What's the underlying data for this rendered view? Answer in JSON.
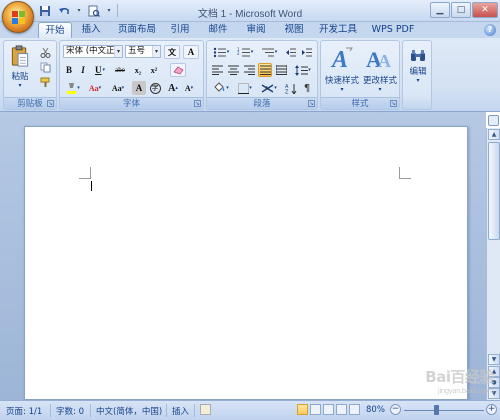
{
  "window": {
    "title": "文档 1 - Microsoft Word",
    "controls": [
      "minimize",
      "maximize",
      "close"
    ]
  },
  "quick_access": [
    "save-icon",
    "undo-icon",
    "redo-icon",
    "print-preview-icon",
    "customize-dropdown-icon"
  ],
  "tabs": [
    {
      "label": "开始",
      "active": true
    },
    {
      "label": "插入"
    },
    {
      "label": "页面布局"
    },
    {
      "label": "引用"
    },
    {
      "label": "邮件"
    },
    {
      "label": "审阅"
    },
    {
      "label": "视图"
    },
    {
      "label": "开发工具"
    },
    {
      "label": "WPS PDF"
    }
  ],
  "ribbon": {
    "clipboard": {
      "label": "剪贴板",
      "paste_label": "粘贴"
    },
    "font": {
      "label": "字体",
      "font_name": "宋体 (中文正文)",
      "font_size": "五号",
      "buttons": [
        "B",
        "I",
        "U",
        "abe",
        "x₂",
        "x²",
        "Aa",
        "A",
        "A",
        "A",
        "A"
      ]
    },
    "paragraph": {
      "label": "段落"
    },
    "styles": {
      "label": "样式",
      "quick_styles": "快速样式",
      "change_styles": "更改样式"
    },
    "editing": {
      "label": "编辑"
    }
  },
  "status": {
    "page": "页面: 1/1",
    "words": "字数: 0",
    "language": "中文(简体，中国)",
    "mode": "插入",
    "zoom": "80%"
  },
  "watermark": {
    "text": "Bai百经验",
    "sub": "jingyan.baidu.com"
  },
  "colors": {
    "ribbon_bg": "#dfe9f6",
    "accent": "#15428b",
    "doc_bg": "#a9bfdc"
  }
}
